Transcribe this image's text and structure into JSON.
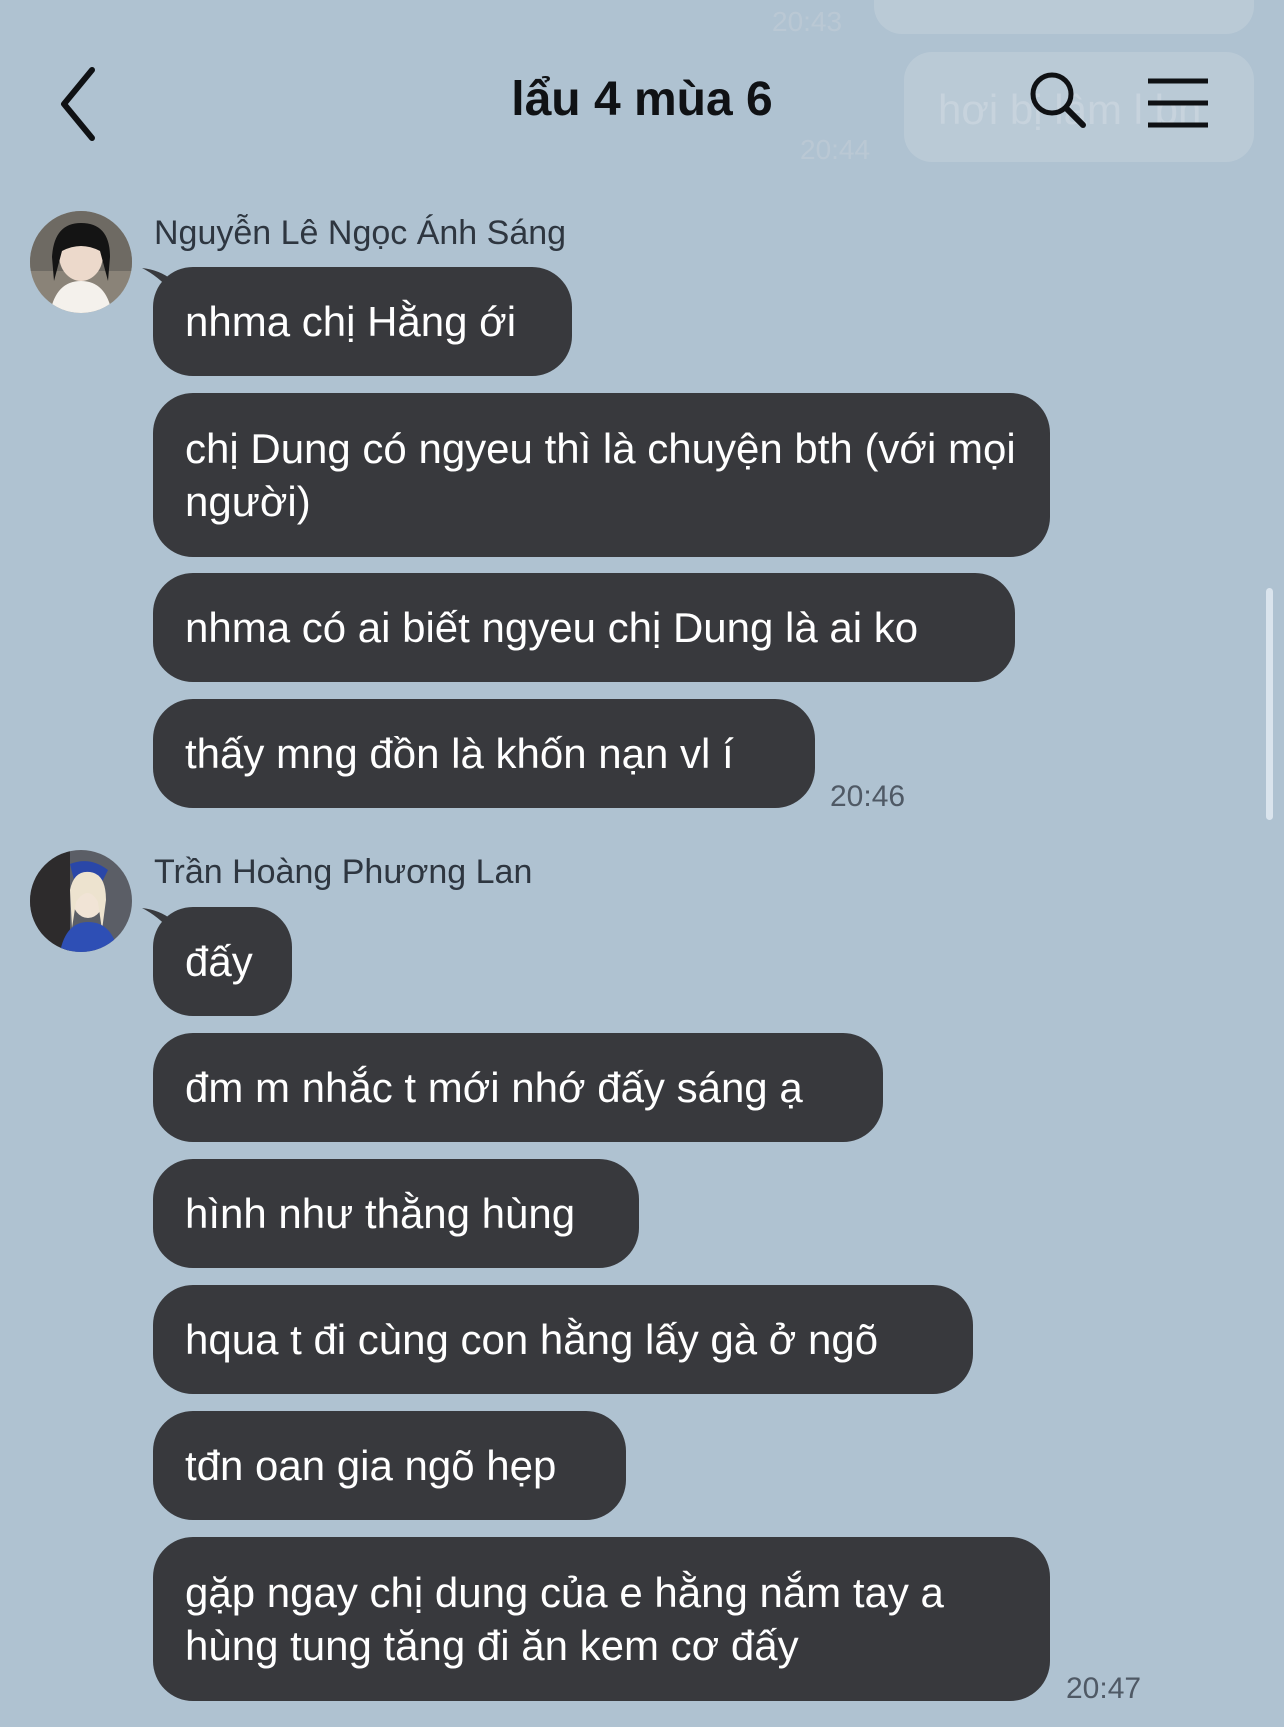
{
  "header": {
    "title": "lẩu 4 mùa 6",
    "back_icon": "chevron-left-icon",
    "search_icon": "search-icon",
    "menu_icon": "hamburger-menu-icon"
  },
  "background_previous": {
    "partial_message": "hơi bị lâm l bn",
    "times": [
      "20:43",
      "20:44"
    ]
  },
  "groups": [
    {
      "sender": "Nguyễn Lê Ngọc Ánh Sáng",
      "messages": [
        "nhma chị Hằng ới",
        "chị Dung có ngyeu thì là chuyện bth (với mọi người)",
        "nhma có ai biết ngyeu chị Dung là ai ko",
        "thấy mng đồn là khốn nạn vl í"
      ],
      "time": "20:46"
    },
    {
      "sender": "Trần Hoàng Phương Lan",
      "messages": [
        "đấy",
        "đm m nhắc t mới nhớ đấy sáng ạ",
        "hình như thằng hùng",
        "hqua t đi cùng con hằng lấy gà ở ngõ",
        "tđn oan gia ngõ hẹp",
        "gặp ngay chị dung của e hằng nắm tay a hùng tung tăng đi ăn kem cơ đấy"
      ],
      "time": "20:47"
    }
  ],
  "colors": {
    "background": "#afc2d1",
    "bubble": "#38393d",
    "bubble_text": "#ffffff",
    "title": "#101215"
  }
}
